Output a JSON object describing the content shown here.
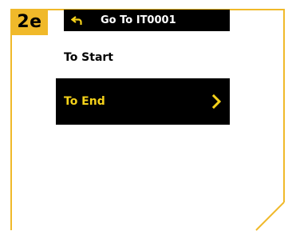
{
  "step_badge": {
    "label": "2e",
    "color": "#f0b92a"
  },
  "header": {
    "back_icon": "back-arrow-icon",
    "title": "Go To IT0001"
  },
  "menu": {
    "items": [
      {
        "label": "To Start",
        "selected": false
      },
      {
        "label": "To End",
        "selected": true,
        "icon": "chevron-right-icon"
      }
    ]
  },
  "colors": {
    "accent": "#f0b92a",
    "highlight_text": "#f5d21a",
    "screen_bg": "#000000"
  }
}
